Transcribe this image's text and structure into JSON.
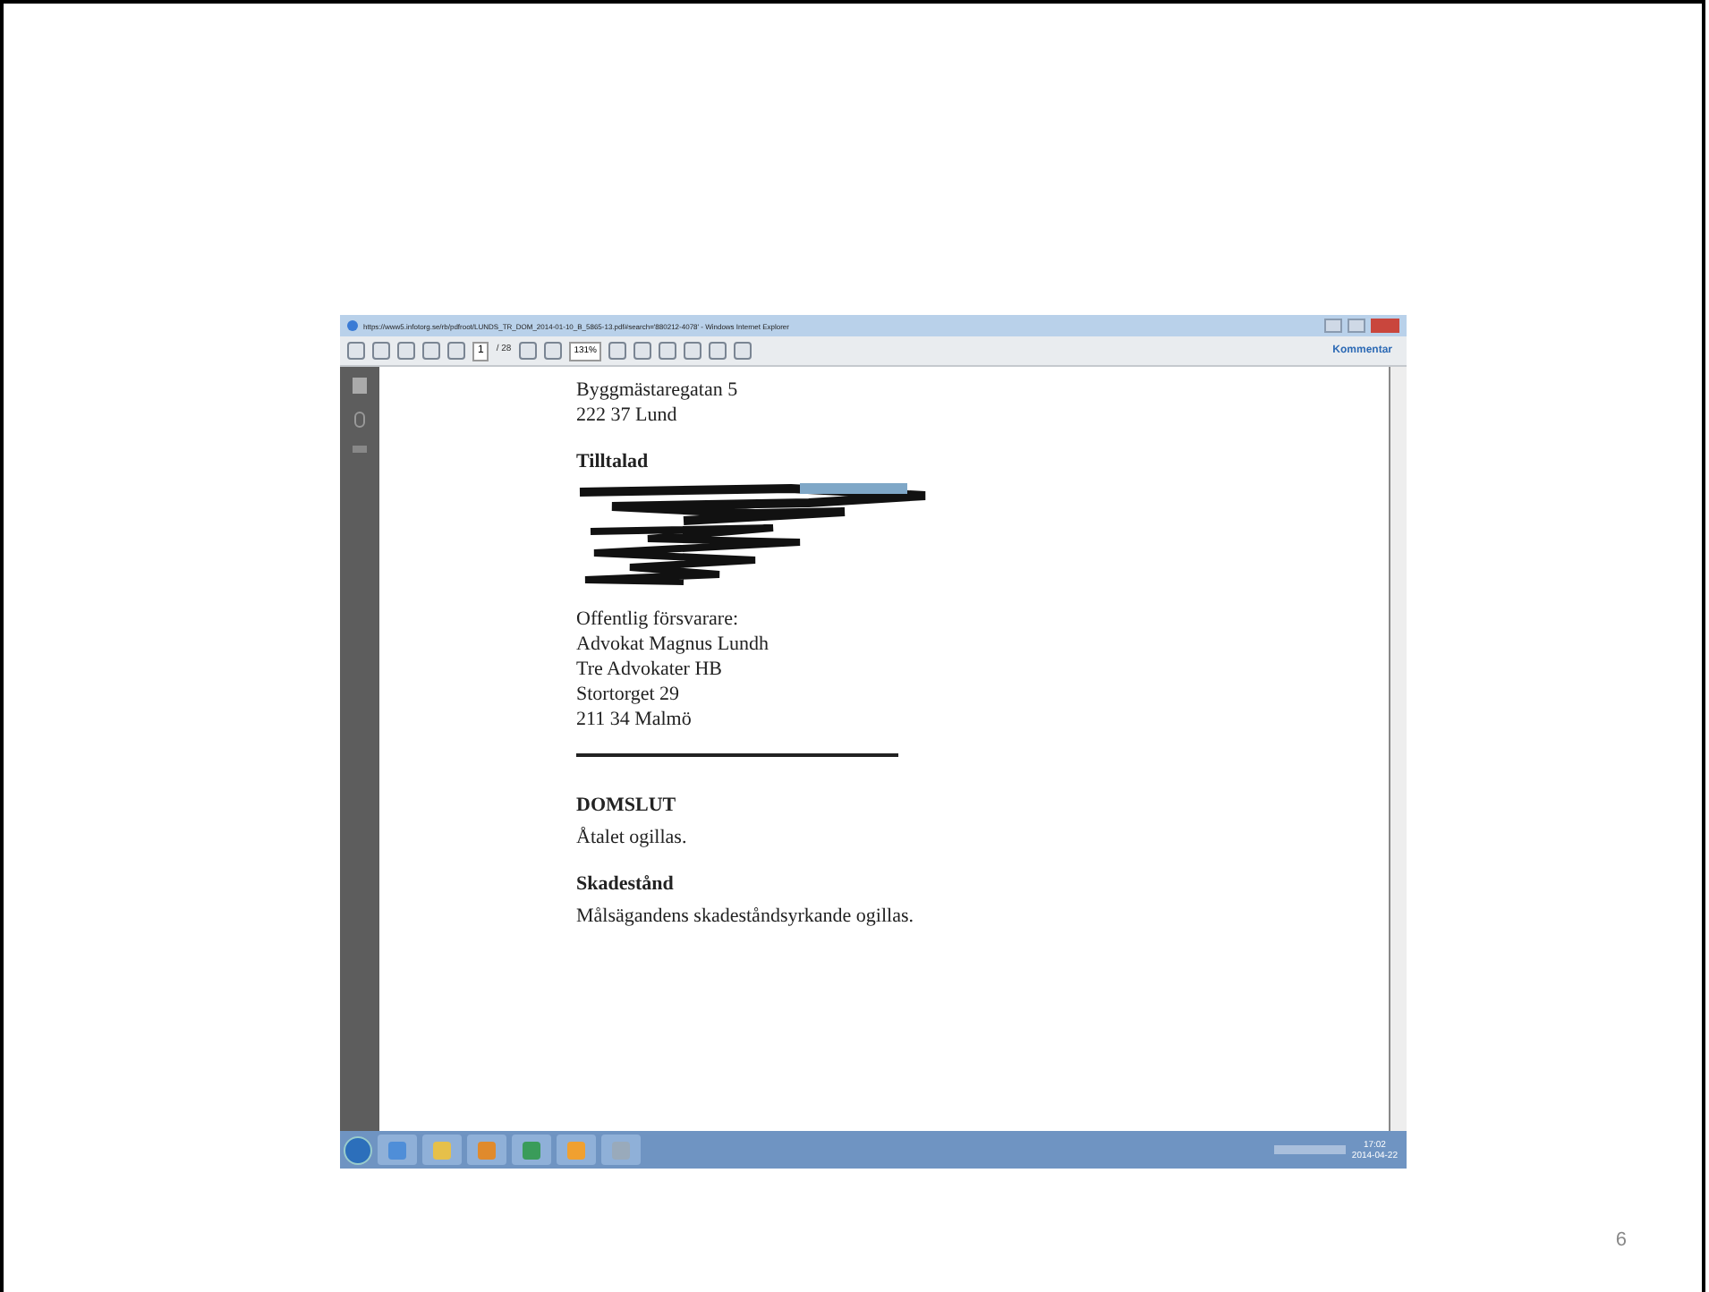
{
  "browser": {
    "title": "https://www5.infotorg.se/rb/pdfroot/LUNDS_TR_DOM_2014-01-10_B_5865-13.pdf#search='880212-4078' - Windows Internet Explorer"
  },
  "toolbar": {
    "page": "1",
    "page_count": "/ 28",
    "zoom": "131%",
    "comment": "Kommentar"
  },
  "document": {
    "blocks": [
      {
        "kind": "text",
        "lines": [
          "Byggmästaregatan 5",
          "222 37 Lund"
        ]
      },
      {
        "kind": "heading",
        "text": "Tilltalad"
      },
      {
        "kind": "redacted"
      },
      {
        "kind": "text",
        "lines": [
          "Offentlig försvarare:",
          "Advokat Magnus Lundh",
          "Tre Advokater HB",
          "Stortorget 29",
          "211 34 Malmö"
        ]
      },
      {
        "kind": "rule"
      },
      {
        "kind": "heading",
        "text": "DOMSLUT"
      },
      {
        "kind": "text",
        "lines": [
          "Åtalet ogillas."
        ]
      },
      {
        "kind": "heading",
        "text": "Skadestånd"
      },
      {
        "kind": "text",
        "lines": [
          "Målsägandens skadeståndsyrkande ogillas."
        ]
      }
    ]
  },
  "taskbar": {
    "time": "17:02",
    "date": "2014-04-22"
  },
  "slide_number": "6"
}
